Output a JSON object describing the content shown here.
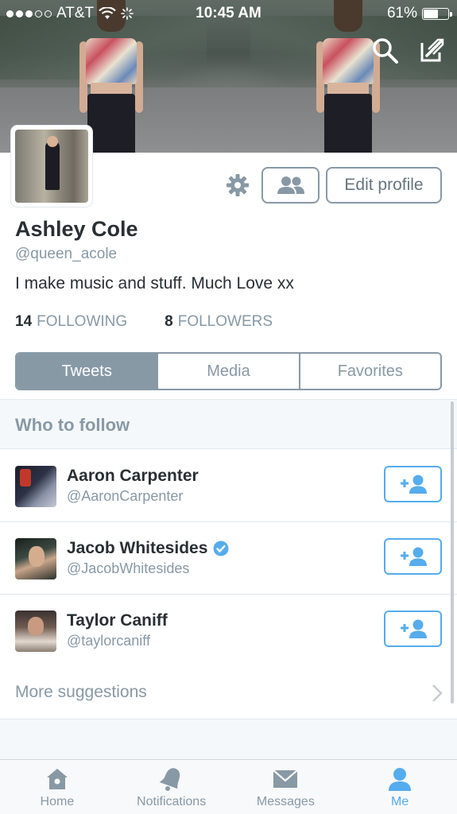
{
  "status_bar": {
    "carrier": "AT&T",
    "time": "10:45 AM",
    "battery_percent": "61%",
    "battery_level": 0.61
  },
  "profile": {
    "name": "Ashley Cole",
    "handle": "@queen_acole",
    "bio": "I make music and stuff. Much Love xx",
    "following_count": "14",
    "following_label": "FOLLOWING",
    "followers_count": "8",
    "followers_label": "FOLLOWERS",
    "edit_profile_label": "Edit profile"
  },
  "tabs": [
    {
      "label": "Tweets",
      "active": true
    },
    {
      "label": "Media",
      "active": false
    },
    {
      "label": "Favorites",
      "active": false
    }
  ],
  "who_to_follow": {
    "title": "Who to follow",
    "users": [
      {
        "name": "Aaron Carpenter",
        "handle": "@AaronCarpenter",
        "verified": false
      },
      {
        "name": "Jacob Whitesides",
        "handle": "@JacobWhitesides",
        "verified": true
      },
      {
        "name": "Taylor Caniff",
        "handle": "@taylorcaniff",
        "verified": false
      }
    ],
    "more_label": "More suggestions"
  },
  "tab_bar": [
    {
      "label": "Home",
      "icon": "home-icon",
      "active": false
    },
    {
      "label": "Notifications",
      "icon": "bell-icon",
      "active": false
    },
    {
      "label": "Messages",
      "icon": "envelope-icon",
      "active": false
    },
    {
      "label": "Me",
      "icon": "person-icon",
      "active": true
    }
  ],
  "colors": {
    "accent": "#55acee",
    "muted": "#8899a6",
    "text": "#292f33"
  }
}
